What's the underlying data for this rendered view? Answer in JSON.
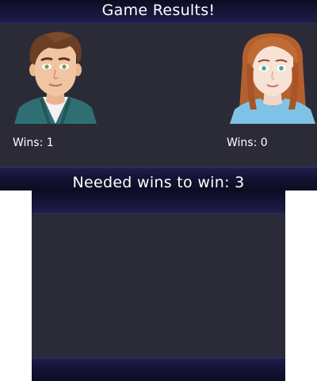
{
  "header": {
    "title": "Game Results!"
  },
  "players": [
    {
      "wins_label": "Wins: 1",
      "avatar_icon": "male-player-avatar"
    },
    {
      "wins_label": "Wins: 0",
      "avatar_icon": "female-player-avatar"
    }
  ],
  "footer": {
    "needed_label": "Needed wins to win: 3"
  },
  "colors": {
    "panel": "#2b2b38",
    "header_bar": "#141436",
    "text": "#ffffff"
  }
}
